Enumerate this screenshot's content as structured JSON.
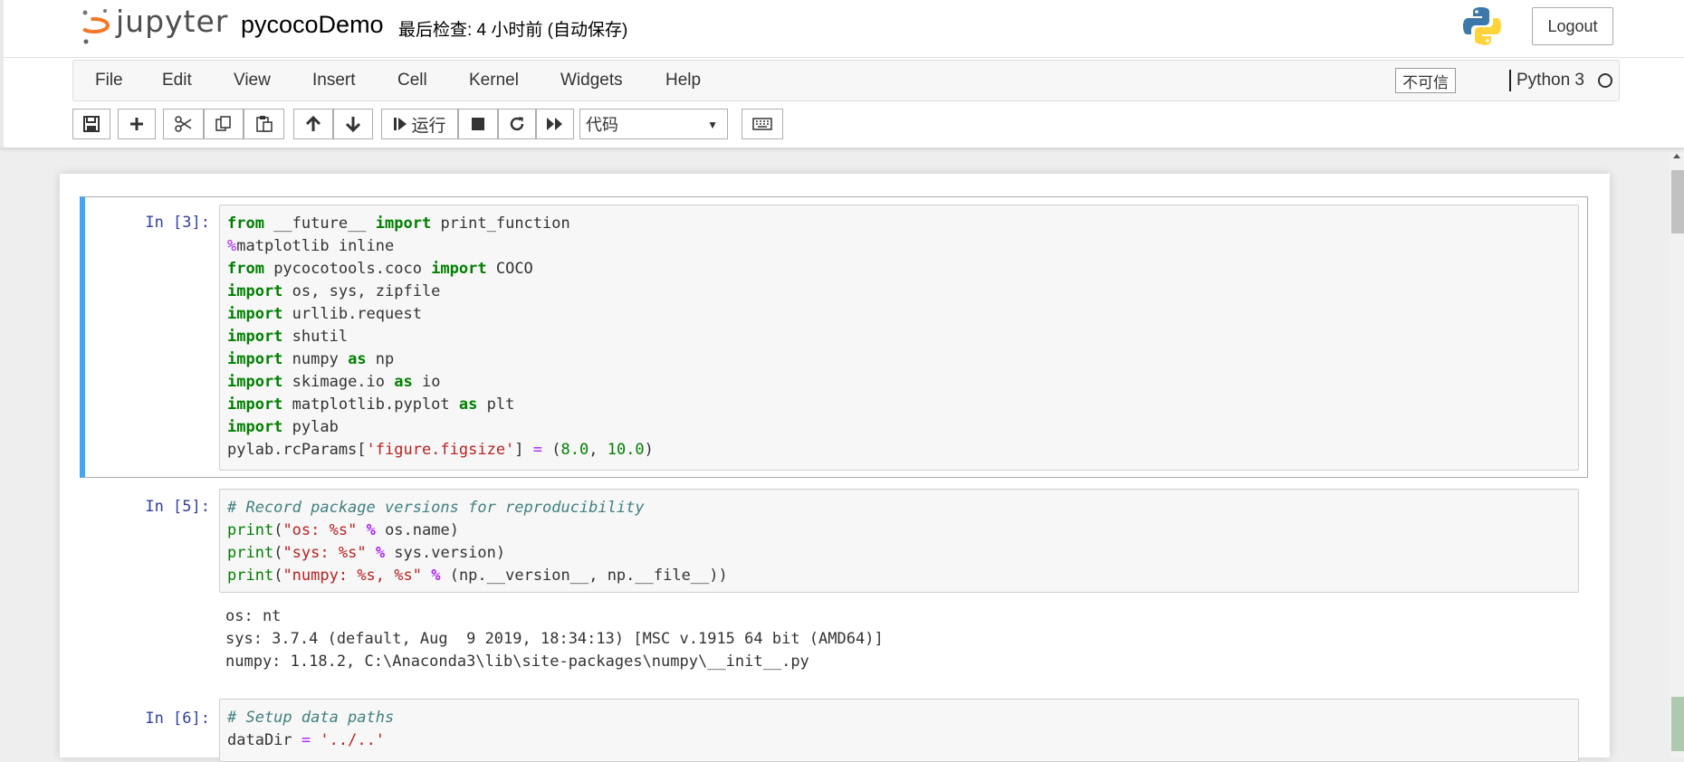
{
  "header": {
    "logo_text": "jupyter",
    "notebook_name": "pycocoDemo",
    "checkpoint": "最后检查: 4 小时前  (自动保存)",
    "logout_label": "Logout"
  },
  "menubar": {
    "items": [
      "File",
      "Edit",
      "View",
      "Insert",
      "Cell",
      "Kernel",
      "Widgets",
      "Help"
    ],
    "trust_label": "不可信",
    "kernel_name": "Python 3"
  },
  "toolbar": {
    "run_label": "运行",
    "cell_type": "代码"
  },
  "cells": [
    {
      "prompt": "In  [3]:",
      "lines": [
        "from __future__ import print_function",
        "%matplotlib inline",
        "from pycocotools.coco import COCO",
        "import os, sys, zipfile",
        "import urllib.request",
        "import shutil",
        "import numpy as np",
        "import skimage.io as io",
        "import matplotlib.pyplot as plt",
        "import pylab",
        "pylab.rcParams['figure.figsize'] = (8.0, 10.0)"
      ]
    },
    {
      "prompt": "In  [5]:",
      "lines": [
        "# Record package versions for reproducibility",
        "print(\"os: %s\" % os.name)",
        "print(\"sys: %s\" % sys.version)",
        "print(\"numpy: %s, %s\" % (np.__version__, np.__file__))"
      ],
      "output": [
        "os: nt",
        "sys: 3.7.4 (default, Aug  9 2019, 18:34:13) [MSC v.1915 64 bit (AMD64)]",
        "numpy: 1.18.2, C:\\Anaconda3\\lib\\site-packages\\numpy\\__init__.py"
      ]
    },
    {
      "prompt": "In  [6]:",
      "lines": [
        "# Setup data paths",
        "dataDir = '../..'"
      ]
    }
  ],
  "colors": {
    "keyword": "#008000",
    "string": "#ba2121",
    "comment": "#408080",
    "magic": "#aa22ff",
    "prompt": "#303f9f",
    "selection_bar": "#42a5f5"
  }
}
